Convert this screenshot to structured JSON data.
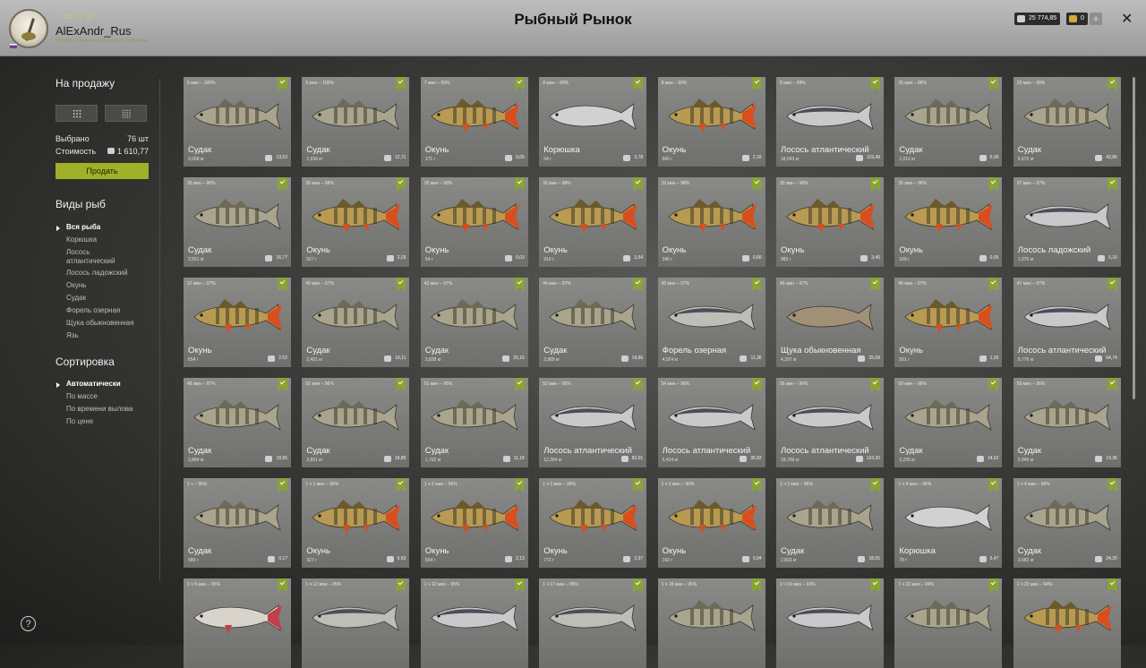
{
  "header": {
    "username": "AlExAndr_Rus",
    "stat_a": "23",
    "stat_b": "37",
    "subtitle": "Россия, каменный посёлок 7 уровень",
    "title": "Рыбный Рынок",
    "silver": "25 774,85",
    "gold": "0",
    "plus": "+",
    "close": "✕"
  },
  "sidebar": {
    "for_sale_heading": "На продажу",
    "selected_label": "Выбрано",
    "selected_value": "76 шт",
    "cost_label": "Стоимость",
    "cost_value": "1 610,77",
    "sell_label": "Продать",
    "fish_types_heading": "Виды рыб",
    "fish_types": [
      "Вся рыба",
      "Корюшка",
      "Лосось\nатлантический",
      "Лосось ладожский",
      "Окунь",
      "Судак",
      "Форель озерная",
      "Щука обыкновенная",
      "Язь"
    ],
    "sort_heading": "Сортировка",
    "sort_options": [
      "Автоматически",
      "По массе",
      "По времени вылова",
      "По цене"
    ]
  },
  "help": "?",
  "fish_colors": {
    "perch": "#b89a52",
    "zander": "#a8a48e",
    "smelt": "#cfd1d3",
    "salmon": "#c9c9cc",
    "trout": "#bfbdb8",
    "pike": "#a09076",
    "ide": "#d8d4cc"
  },
  "cards": [
    {
      "time": "5 мин – 100%",
      "name": "Судак",
      "weight": "2,058 кг",
      "price": "13,53",
      "kind": "zander"
    },
    {
      "time": "5 мин – 100%",
      "name": "Судак",
      "weight": "1,934 кг",
      "price": "12,71",
      "kind": "zander"
    },
    {
      "time": "7 мин – 99%",
      "name": "Окунь",
      "weight": "171 г",
      "price": "0,05",
      "kind": "perch"
    },
    {
      "time": "8 мин – 99%",
      "name": "Корюшка",
      "weight": "54 г",
      "price": "3,78",
      "kind": "smelt"
    },
    {
      "time": "8 мин – 99%",
      "name": "Окунь",
      "weight": "560 г",
      "price": "2,16",
      "kind": "perch"
    },
    {
      "time": "8 мин – 99%",
      "name": "Лосось атлантический",
      "weight": "18,043 кг",
      "price": "119,49",
      "kind": "salmon"
    },
    {
      "time": "25 мин – 98%",
      "name": "Судак",
      "weight": "1,012 кг",
      "price": "0,30",
      "kind": "zander"
    },
    {
      "time": "26 мин – 98%",
      "name": "Судак",
      "weight": "6,672 кг",
      "price": "43,86",
      "kind": "zander"
    },
    {
      "time": "30 мин – 98%",
      "name": "Судак",
      "weight": "2,551 кг",
      "price": "16,77",
      "kind": "zander"
    },
    {
      "time": "30 мин – 98%",
      "name": "Окунь",
      "weight": "527 г",
      "price": "2,03",
      "kind": "perch"
    },
    {
      "time": "30 мин – 98%",
      "name": "Окунь",
      "weight": "54 г",
      "price": "0,03",
      "kind": "perch"
    },
    {
      "time": "32 мин – 98%",
      "name": "Окунь",
      "weight": "919 г",
      "price": "3,54",
      "kind": "perch"
    },
    {
      "time": "33 мин – 98%",
      "name": "Окунь",
      "weight": "345 г",
      "price": "0,66",
      "kind": "perch"
    },
    {
      "time": "35 мин – 98%",
      "name": "Окунь",
      "weight": "883 г",
      "price": "3,40",
      "kind": "perch"
    },
    {
      "time": "35 мин – 98%",
      "name": "Окунь",
      "weight": "169 г",
      "price": "0,05",
      "kind": "perch"
    },
    {
      "time": "37 мин – 97%",
      "name": "Лосось ладожский",
      "weight": "1,075 кг",
      "price": "5,16",
      "kind": "salmon"
    },
    {
      "time": "37 мин – 97%",
      "name": "Окунь",
      "weight": "654 г",
      "price": "2,52",
      "kind": "perch"
    },
    {
      "time": "40 мин – 97%",
      "name": "Судак",
      "weight": "2,451 кг",
      "price": "16,11",
      "kind": "zander"
    },
    {
      "time": "42 мин – 97%",
      "name": "Судак",
      "weight": "3,828 кг",
      "price": "25,16",
      "kind": "zander"
    },
    {
      "time": "44 мин – 97%",
      "name": "Судак",
      "weight": "2,989 кг",
      "price": "19,66",
      "kind": "zander"
    },
    {
      "time": "45 мин – 97%",
      "name": "Форель озерная",
      "weight": "4,024 кг",
      "price": "11,36",
      "kind": "trout"
    },
    {
      "time": "45 мин – 97%",
      "name": "Щука обыкновенная",
      "weight": "4,397 кг",
      "price": "25,08",
      "kind": "pike"
    },
    {
      "time": "46 мин – 97%",
      "name": "Окунь",
      "weight": "501 г",
      "price": "1,93",
      "kind": "perch"
    },
    {
      "time": "47 мин – 97%",
      "name": "Лосось атлантический",
      "weight": "9,776 кг",
      "price": "64,74",
      "kind": "salmon"
    },
    {
      "time": "48 мин – 97%",
      "name": "Судак",
      "weight": "2,884 кг",
      "price": "18,96",
      "kind": "zander"
    },
    {
      "time": "51 мин – 96%",
      "name": "Судак",
      "weight": "2,861 кг",
      "price": "18,80",
      "kind": "zander"
    },
    {
      "time": "51 мин – 96%",
      "name": "Судак",
      "weight": "1,702 кг",
      "price": "11,18",
      "kind": "zander"
    },
    {
      "time": "52 мин – 96%",
      "name": "Лосось атлантический",
      "weight": "12,394 кг",
      "price": "82,01",
      "kind": "salmon"
    },
    {
      "time": "54 мин – 96%",
      "name": "Лосось атлантический",
      "weight": "5,424 кг",
      "price": "35,92",
      "kind": "salmon"
    },
    {
      "time": "56 мин – 96%",
      "name": "Лосось атлантический",
      "weight": "18,769 кг",
      "price": "124,30",
      "kind": "salmon"
    },
    {
      "time": "59 мин – 96%",
      "name": "Судак",
      "weight": "2,225 кг",
      "price": "14,62",
      "kind": "zander"
    },
    {
      "time": "59 мин – 96%",
      "name": "Судак",
      "weight": "2,945 кг",
      "price": "19,36",
      "kind": "zander"
    },
    {
      "time": "1 ч – 96%",
      "name": "Судак",
      "weight": "580 г",
      "price": "0,17",
      "kind": "zander"
    },
    {
      "time": "1 ч 1 мин – 96%",
      "name": "Окунь",
      "weight": "327 г",
      "price": "0,63",
      "kind": "perch"
    },
    {
      "time": "1 ч 2 мин – 96%",
      "name": "Окунь",
      "weight": "554 г",
      "price": "2,13",
      "kind": "perch"
    },
    {
      "time": "1 ч 2 мин – 96%",
      "name": "Окунь",
      "weight": "772 г",
      "price": "2,97",
      "kind": "perch"
    },
    {
      "time": "1 ч 3 мин – 96%",
      "name": "Окунь",
      "weight": "162 г",
      "price": "0,04",
      "kind": "perch"
    },
    {
      "time": "1 ч 3 мин – 96%",
      "name": "Судак",
      "weight": "2,823 кг",
      "price": "18,55",
      "kind": "zander"
    },
    {
      "time": "1 ч 4 мин – 96%",
      "name": "Корюшка",
      "weight": "78 г",
      "price": "5,47",
      "kind": "smelt"
    },
    {
      "time": "1 ч 4 мин – 96%",
      "name": "Судак",
      "weight": "3,682 кг",
      "price": "24,20",
      "kind": "zander"
    },
    {
      "time": "1 ч 9 мин – 95%",
      "name": "",
      "weight": "",
      "price": "",
      "kind": "ide"
    },
    {
      "time": "1 ч 12 мин – 95%",
      "name": "",
      "weight": "",
      "price": "",
      "kind": "trout"
    },
    {
      "time": "1 ч 12 мин – 95%",
      "name": "",
      "weight": "",
      "price": "",
      "kind": "salmon"
    },
    {
      "time": "1 ч 17 мин – 95%",
      "name": "",
      "weight": "",
      "price": "",
      "kind": "trout"
    },
    {
      "time": "1 ч 18 мин – 95%",
      "name": "",
      "weight": "",
      "price": "",
      "kind": "zander"
    },
    {
      "time": "1 ч 19 мин – 94%",
      "name": "",
      "weight": "",
      "price": "",
      "kind": "salmon"
    },
    {
      "time": "1 ч 22 мин – 94%",
      "name": "",
      "weight": "",
      "price": "",
      "kind": "zander"
    },
    {
      "time": "1 ч 22 мин – 94%",
      "name": "",
      "weight": "",
      "price": "",
      "kind": "perch"
    }
  ]
}
